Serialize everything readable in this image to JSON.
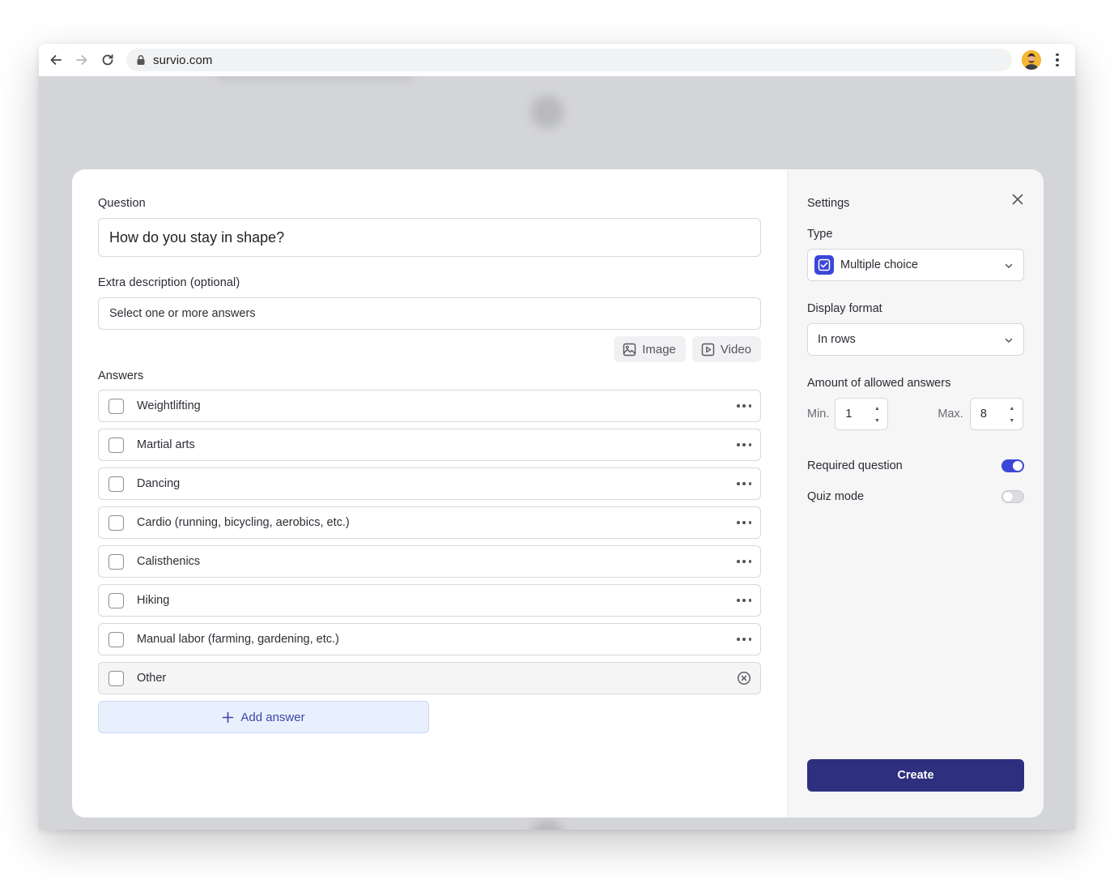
{
  "browser": {
    "url": "survio.com"
  },
  "question": {
    "label": "Question",
    "value": "How do you stay in shape?"
  },
  "description": {
    "label": "Extra description (optional)",
    "value": "Select one or more answers"
  },
  "media": {
    "image_label": "Image",
    "video_label": "Video"
  },
  "answers": {
    "label": "Answers",
    "items": [
      "Weightlifting",
      "Martial arts",
      "Dancing",
      "Cardio (running, bicycling, aerobics, etc.)",
      "Calisthenics",
      "Hiking",
      "Manual labor (farming, gardening, etc.)"
    ],
    "other": "Other",
    "add_label": "Add answer"
  },
  "settings": {
    "title": "Settings",
    "type_label": "Type",
    "type_value": "Multiple choice",
    "display_format_label": "Display format",
    "display_format_value": "In rows",
    "amount_label": "Amount of allowed answers",
    "min_label": "Min.",
    "min_value": "1",
    "max_label": "Max.",
    "max_value": "8",
    "required_label": "Required question",
    "required_on": true,
    "quiz_label": "Quiz mode",
    "quiz_on": false,
    "create_label": "Create"
  },
  "colors": {
    "accent": "#3b47d6",
    "primary_button": "#2e2f7e",
    "add_answer_bg": "#e9f0fd",
    "add_answer_text": "#3c46a6"
  }
}
